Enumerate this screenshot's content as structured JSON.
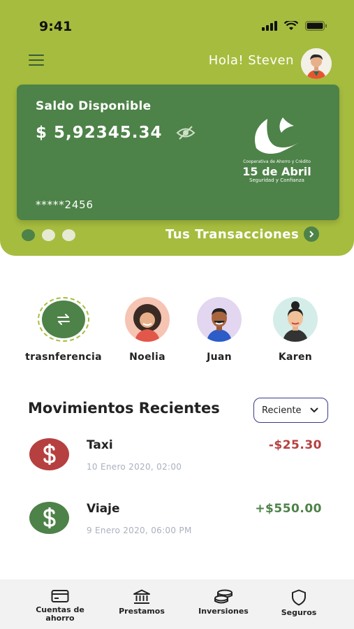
{
  "status_bar": {
    "time": "9:41"
  },
  "header": {
    "greeting": "Hola! Steven"
  },
  "card": {
    "title": "Saldo Disponible",
    "balance": "$ 5,92345.34",
    "number": "*****2456",
    "logo": {
      "small_text": "Cooperativa de Ahorro y Crédito",
      "name": "15 de Abril",
      "tagline": "Seguridad y Confianza"
    }
  },
  "carousel": {
    "pages": 3,
    "active_index": 0
  },
  "transactions_link": {
    "label": "Tus Transacciones"
  },
  "contacts": [
    {
      "label": "trasnferencia",
      "icon": "transfer-icon"
    },
    {
      "label": "Noelia",
      "icon": "avatar-noelia"
    },
    {
      "label": "Juan",
      "icon": "avatar-juan"
    },
    {
      "label": "Karen",
      "icon": "avatar-karen"
    }
  ],
  "recent": {
    "title": "Movimientos Recientes",
    "filter": {
      "selected": "Reciente"
    },
    "items": [
      {
        "name": "Taxi",
        "date": "10 Enero 2020, 02:00",
        "amount": "-$25.30",
        "type": "debit"
      },
      {
        "name": "Viaje",
        "date": "9 Enero 2020, 06:00 PM",
        "amount": "+$550.00",
        "type": "credit"
      }
    ]
  },
  "bottom_nav": [
    {
      "label": "Cuentas de ahorro",
      "icon": "card-icon"
    },
    {
      "label": "Prestamos",
      "icon": "bank-icon"
    },
    {
      "label": "Inversiones",
      "icon": "coins-icon"
    },
    {
      "label": "Seguros",
      "icon": "shield-icon"
    }
  ],
  "colors": {
    "header_bg": "#a6bc3e",
    "card_bg": "#4d8248",
    "debit": "#b5403f",
    "credit": "#4d8248",
    "nav_bg": "#f2f2f2"
  }
}
